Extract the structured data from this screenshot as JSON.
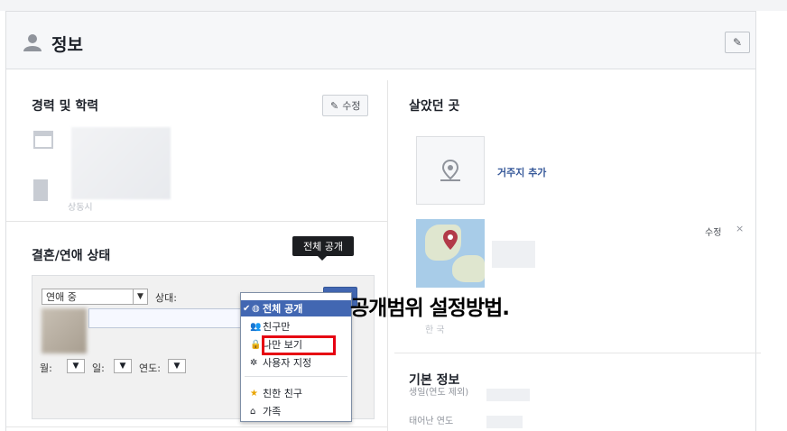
{
  "header": {
    "title": "정보",
    "edit_icon": "pencil-icon"
  },
  "work_education": {
    "title": "경력 및 학력",
    "edit_label": "수정",
    "faded_text": "상동시"
  },
  "relationship": {
    "title": "결혼/연애 상태",
    "status_value": "연애 중",
    "with_label": "상대:",
    "month_label": "월:",
    "day_label": "일:",
    "year_label": "연도:"
  },
  "privacy": {
    "tooltip": "전체 공개",
    "options": [
      {
        "label": "전체 공개",
        "icon": "globe-icon",
        "selected": true
      },
      {
        "label": "친구만",
        "icon": "friends-icon",
        "selected": false
      },
      {
        "label": "나만 보기",
        "icon": "lock-icon",
        "selected": false
      },
      {
        "label": "사용자 지정",
        "icon": "gear-icon",
        "selected": false
      },
      {
        "label": "친한 친구",
        "icon": "star-icon",
        "selected": false
      },
      {
        "label": "가족",
        "icon": "house-icon",
        "selected": false
      }
    ],
    "highlight_color": "#e60012"
  },
  "caption": "공개범위 설정방법.",
  "places": {
    "title": "살았던 곳",
    "add_city_label": "거주지 추가",
    "edit_label": "수정",
    "close_label": "×",
    "faded_text": "한 국"
  },
  "basic_info": {
    "title": "기본 정보",
    "birthday_label": "생일(연도 제외)",
    "birthyear_label": "태어난 연도"
  },
  "colors": {
    "accent": "#4267b2",
    "link": "#365899"
  }
}
